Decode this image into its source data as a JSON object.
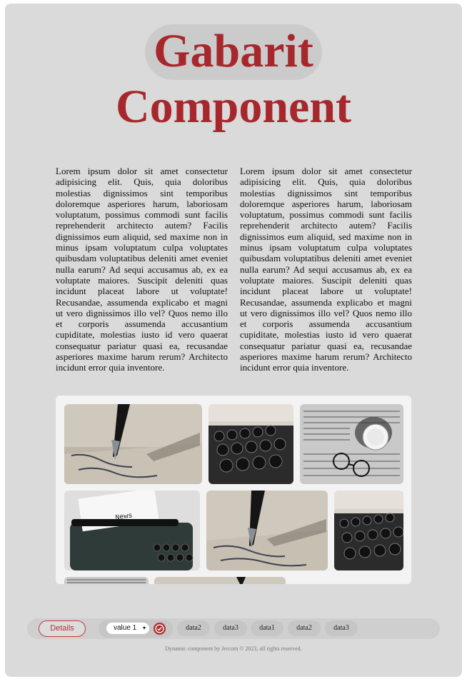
{
  "title": {
    "line1": "Gabarit",
    "line2": "Component"
  },
  "columns": [
    "Lorem ipsum dolor sit amet consectetur adipisicing elit. Quis, quia doloribus molestias dignissimos sint temporibus doloremque asperiores harum, laboriosam voluptatum, possimus commodi sunt facilis reprehenderit architecto autem? Facilis dignissimos eum aliquid, sed maxime non in minus ipsam voluptatum culpa voluptates quibusdam voluptatibus deleniti amet eveniet nulla earum? Ad sequi accusamus ab, ex ea voluptate maiores. Suscipit deleniti quas incidunt placeat labore ut voluptate! Recusandae, assumenda explicabo et magni ut vero dignissimos illo vel? Quos nemo illo et corporis assumenda accusantium cupiditate, molestias iusto id vero quaerat consequatur pariatur quasi ea, recusandae asperiores maxime harum rerum? Architecto incidunt error quia inventore.",
    "Lorem ipsum dolor sit amet consectetur adipisicing elit. Quis, quia doloribus molestias dignissimos sint temporibus doloremque asperiores harum, laboriosam voluptatum, possimus commodi sunt facilis reprehenderit architecto autem? Facilis dignissimos eum aliquid, sed maxime non in minus ipsam voluptatum culpa voluptates quibusdam voluptatibus deleniti amet eveniet nulla earum? Ad sequi accusamus ab, ex ea voluptate maiores. Suscipit deleniti quas incidunt placeat labore ut voluptate! Recusandae, assumenda explicabo et magni ut vero dignissimos illo vel? Quos nemo illo et corporis assumenda accusantium cupiditate, molestias iusto id vero quaerat consequatur pariatur quasi ea, recusandae asperiores maxime harum rerum? Architecto incidunt error quia inventore."
  ],
  "gallery": {
    "photos": [
      {
        "subject": "fountain-pen"
      },
      {
        "subject": "typewriter-keys"
      },
      {
        "subject": "newspaper-coffee-glasses"
      },
      {
        "subject": "typewriter-news"
      },
      {
        "subject": "fountain-pen"
      },
      {
        "subject": "typewriter-keys"
      },
      {
        "subject": "newspaper"
      },
      {
        "subject": "fountain-pen"
      }
    ],
    "news_paper_text": "News"
  },
  "footer": {
    "details_label": "Details",
    "select_value": "value 1",
    "chips": [
      "data2",
      "data3",
      "data1",
      "data2",
      "data3"
    ],
    "copyright": "Dynamic component by Jercom © 2023, all rights reserved."
  },
  "colors": {
    "accent": "#a7282c",
    "background": "#dadada",
    "gallery_bg": "#f3f3f3"
  }
}
